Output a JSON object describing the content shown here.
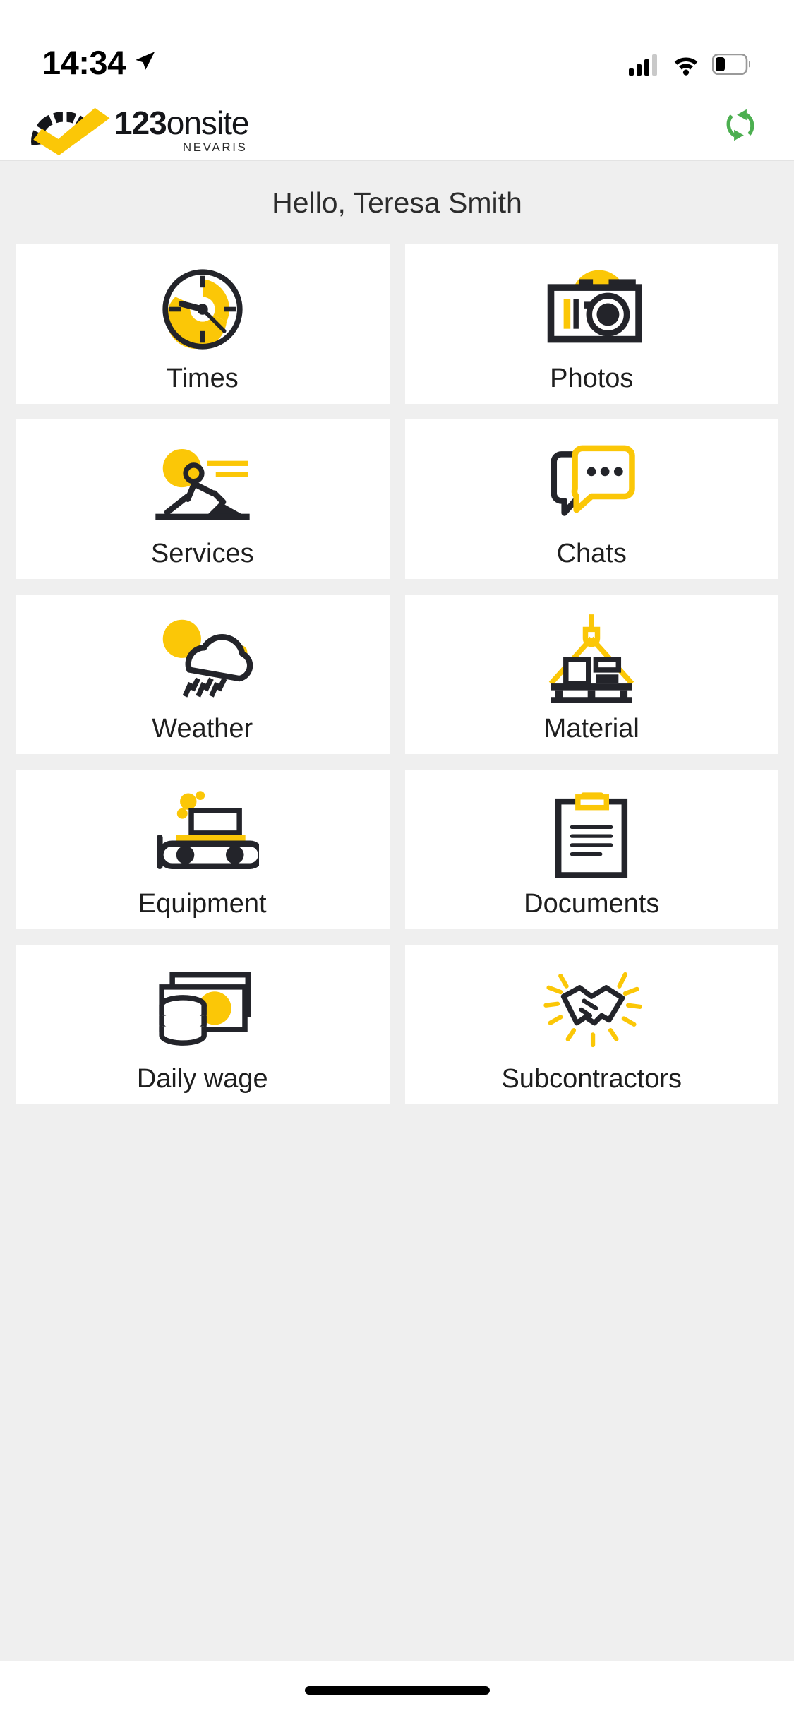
{
  "status_bar": {
    "time": "14:34",
    "location_icon": "location-arrow-icon",
    "cellular_icon": "cellular-signal-icon",
    "wifi_icon": "wifi-icon",
    "battery_icon": "battery-low-icon",
    "battery_level_pct": 25
  },
  "header": {
    "logo_number": "123",
    "logo_name": "onsite",
    "logo_subtitle": "NEVARIS",
    "logo_mark_icon": "checkmark-gauge-logo-icon",
    "sync_icon": "sync-refresh-icon",
    "sync_color": "#4caf50"
  },
  "greeting": {
    "text": "Hello, Teresa Smith"
  },
  "colors": {
    "accent_yellow": "#fbc707",
    "ink": "#23242a",
    "page_bg": "#efefef",
    "tile_bg": "#ffffff",
    "sync_green": "#4caf50"
  },
  "grid": {
    "tiles": [
      {
        "label": "Times",
        "icon": "clock-icon"
      },
      {
        "label": "Photos",
        "icon": "camera-icon"
      },
      {
        "label": "Services",
        "icon": "worker-shovel-icon"
      },
      {
        "label": "Chats",
        "icon": "chat-bubbles-icon"
      },
      {
        "label": "Weather",
        "icon": "sun-cloud-rain-icon"
      },
      {
        "label": "Material",
        "icon": "crane-pallet-icon"
      },
      {
        "label": "Equipment",
        "icon": "bulldozer-icon"
      },
      {
        "label": "Documents",
        "icon": "clipboard-icon"
      },
      {
        "label": "Daily wage",
        "icon": "money-coins-icon"
      },
      {
        "label": "Subcontractors",
        "icon": "handshake-icon"
      }
    ]
  },
  "home_indicator": {
    "icon": "home-indicator-bar"
  }
}
